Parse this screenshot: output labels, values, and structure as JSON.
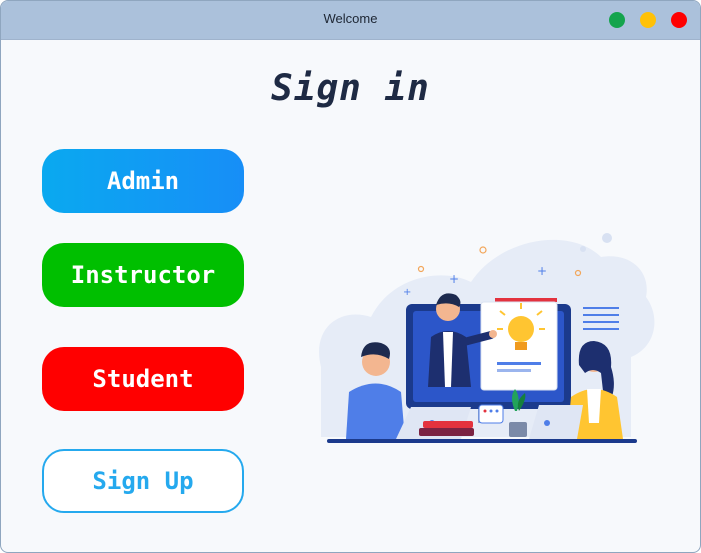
{
  "window": {
    "title": "Welcome",
    "controls": [
      "green-dot",
      "yellow-dot",
      "red-dot"
    ]
  },
  "main": {
    "title": "Sign in",
    "buttons": {
      "admin": "Admin",
      "instructor": "Instructor",
      "student": "Student",
      "signup": "Sign Up"
    }
  },
  "colors": {
    "titlebar": "#abc1db",
    "admin": "#0aa9f0",
    "instructor": "#00bf00",
    "student": "#ff0000",
    "signup_outline": "#25a9ee",
    "title_text": "#1e2a44"
  },
  "illustration": {
    "icon": "online-classroom-illustration"
  }
}
